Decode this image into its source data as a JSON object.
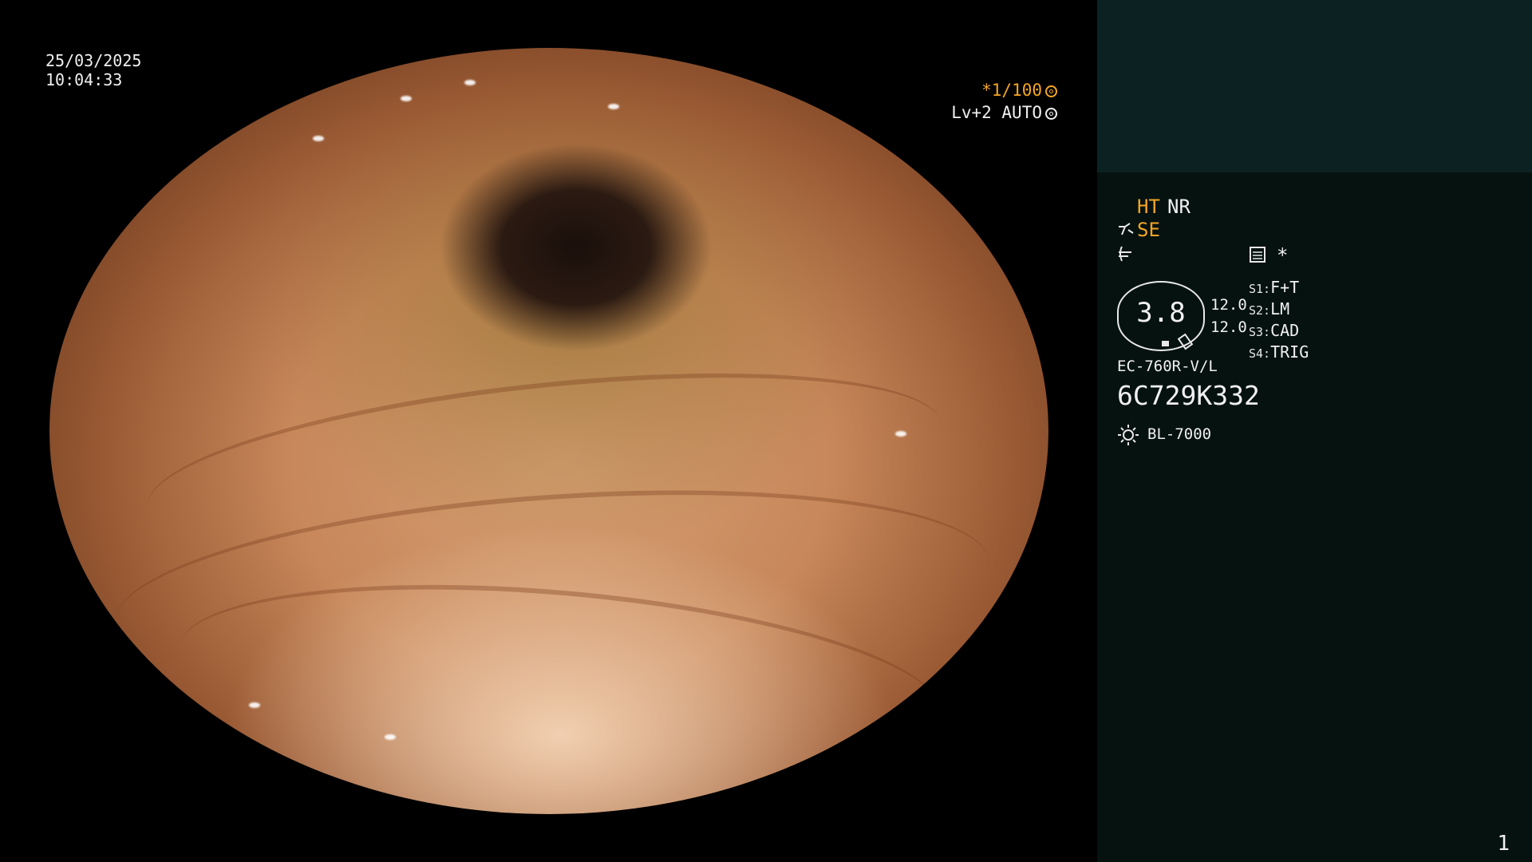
{
  "overlay": {
    "date": "25/03/2025",
    "time": "10:04:33",
    "shutter": "*1/100",
    "level": "Lv+2 AUTO"
  },
  "panel": {
    "mode_ht": "HT",
    "mode_nr": "NR",
    "mode_se": "SE",
    "star": "*",
    "zoom_value": "3.8",
    "value_a": "12.0",
    "value_b": "12.0",
    "scope_settings": [
      {
        "key": "S1:",
        "value": "F+T"
      },
      {
        "key": "S2:",
        "value": "LM"
      },
      {
        "key": "S3:",
        "value": "CAD"
      },
      {
        "key": "S4:",
        "value": "TRIG"
      }
    ],
    "scope_model": "EC-760R-V/L",
    "serial": "6C729K332",
    "light_source": "BL-7000",
    "page_number": "1"
  },
  "colors": {
    "accent": "#f5a623",
    "panel_bg": "#051210",
    "panel_top": "#0c2222"
  }
}
